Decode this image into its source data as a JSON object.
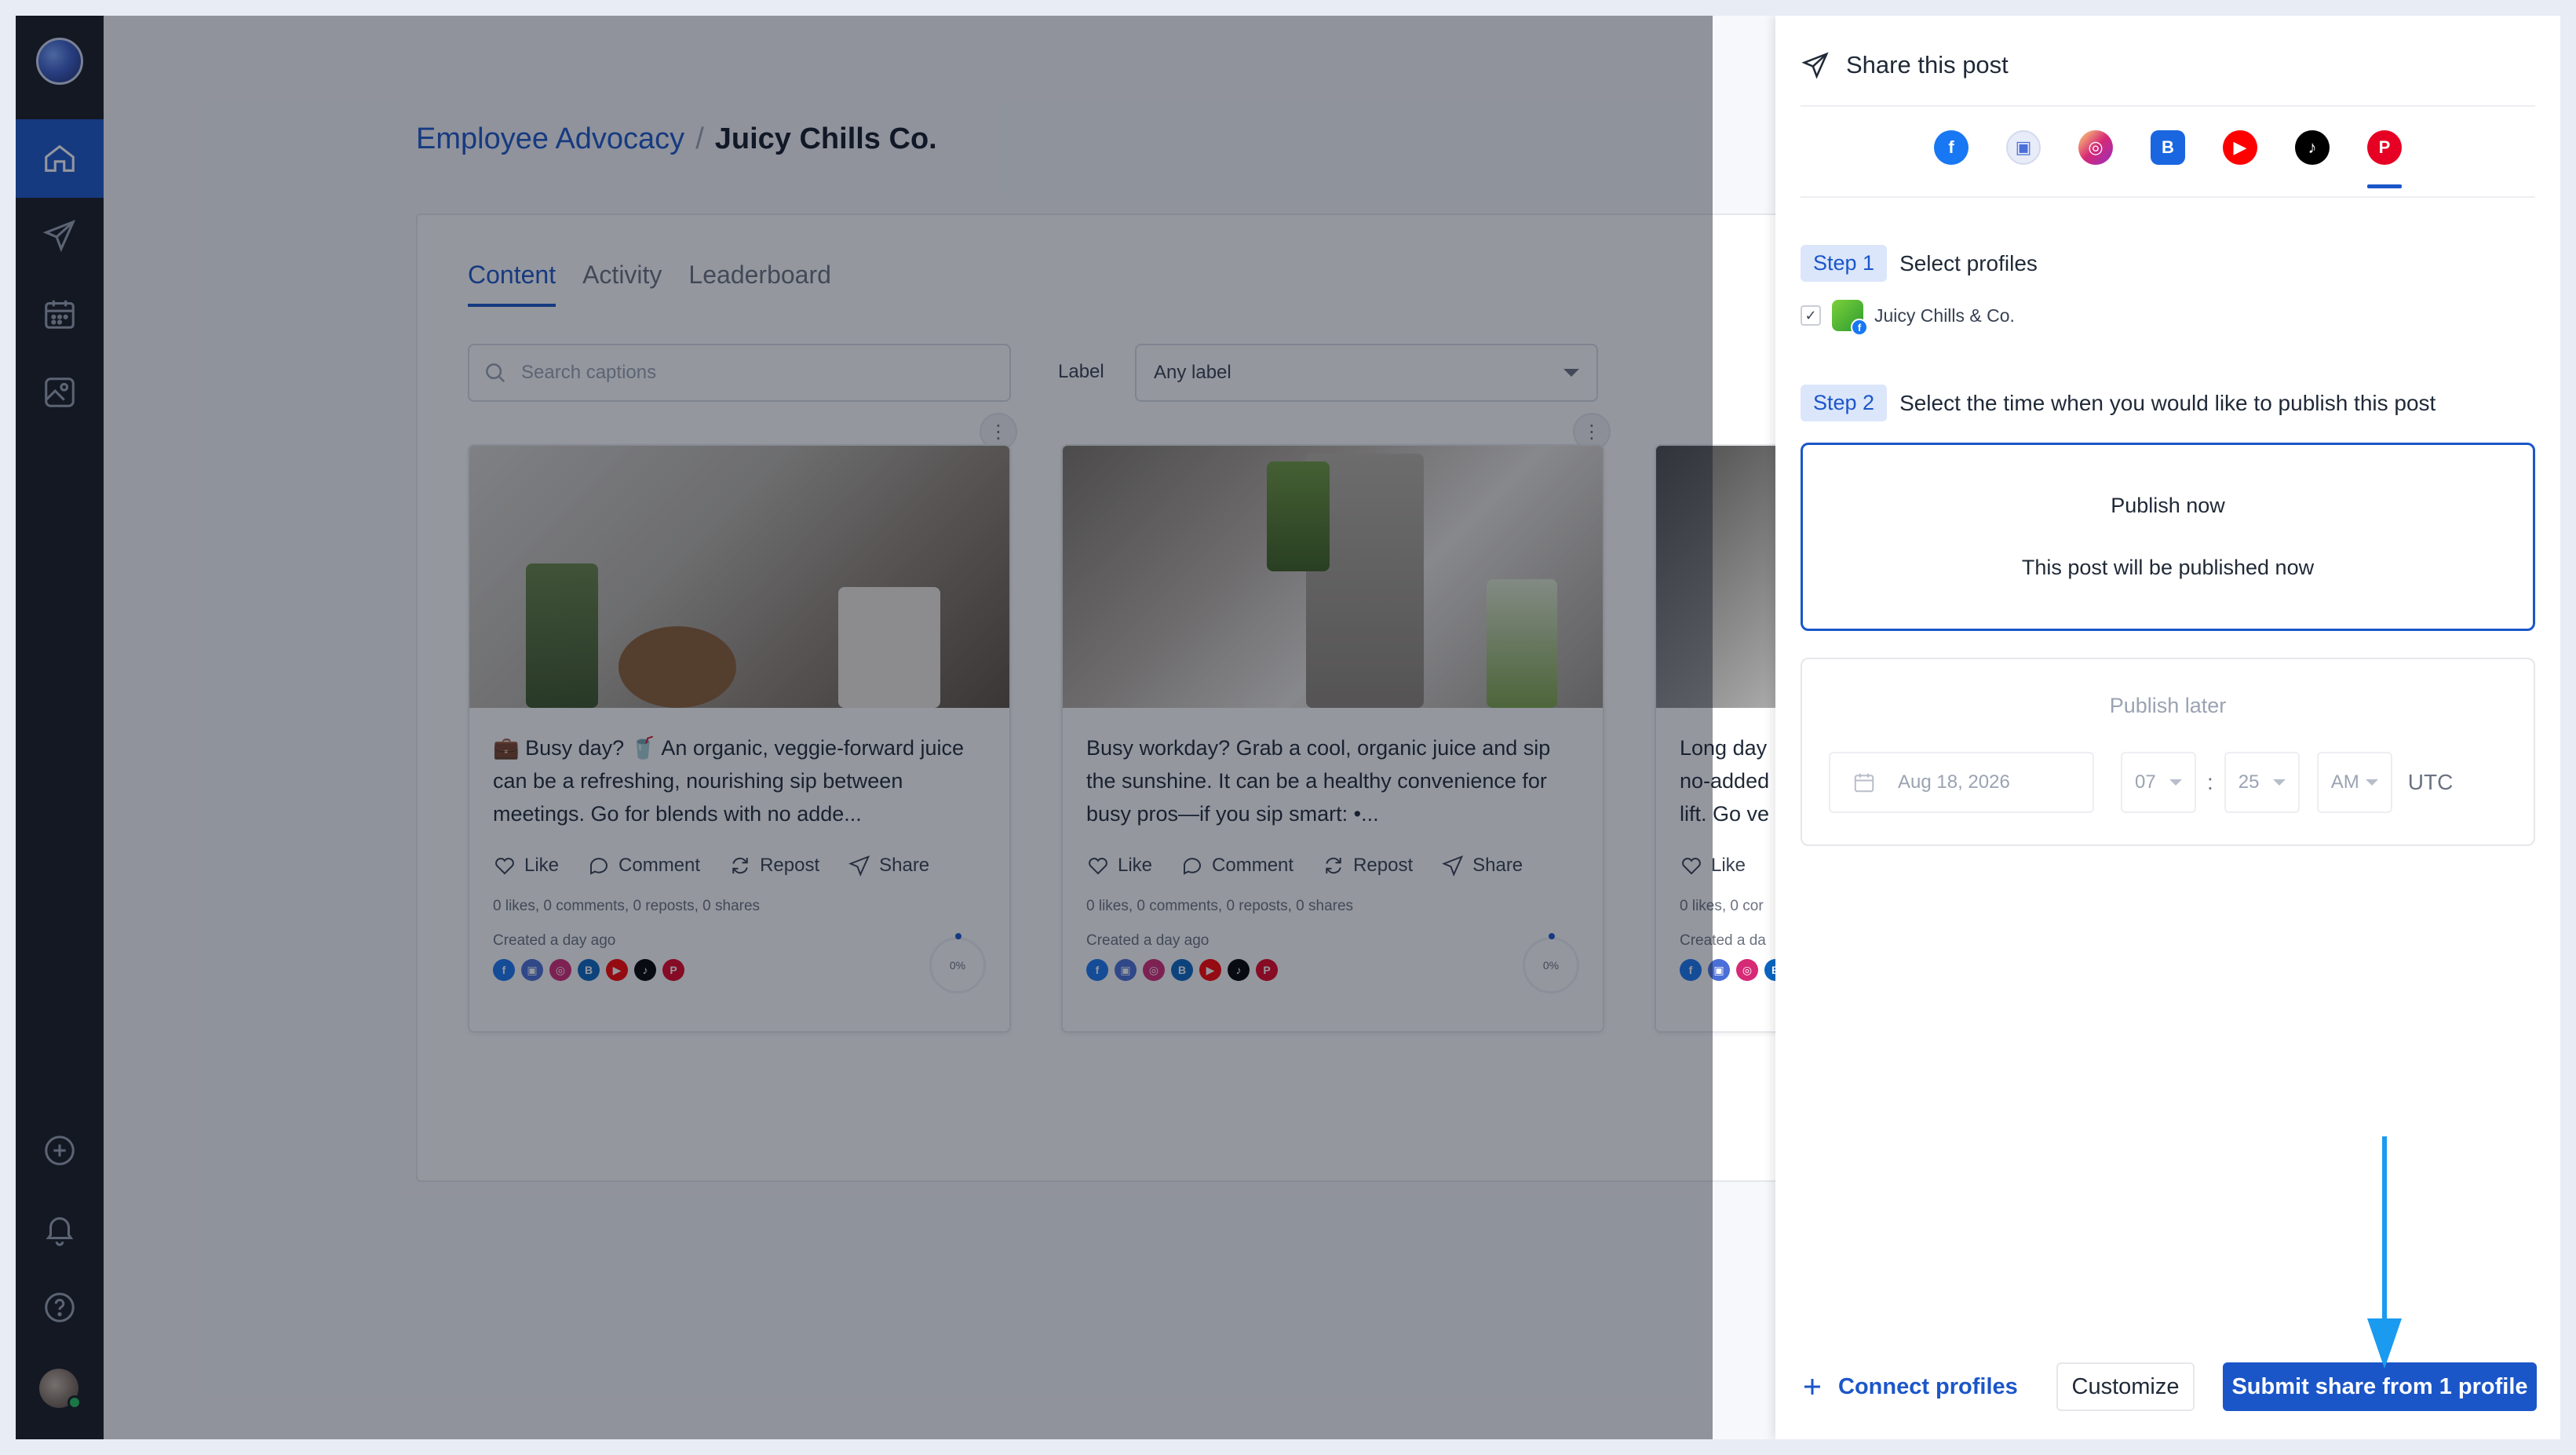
{
  "colors": {
    "accent": "#1b56c9",
    "sidebar_bg": "#14181f",
    "annotation_arrow": "#1a9bf0"
  },
  "sidebar": {
    "items": [
      {
        "icon": "home-icon",
        "active": true
      },
      {
        "icon": "send-icon",
        "active": false
      },
      {
        "icon": "calendar-icon",
        "active": false
      },
      {
        "icon": "image-icon",
        "active": false
      }
    ],
    "bottom_items": [
      {
        "icon": "plus-circle-icon"
      },
      {
        "icon": "bell-icon"
      },
      {
        "icon": "help-icon"
      }
    ]
  },
  "breadcrumb": {
    "parent": "Employee Advocacy",
    "separator": "/",
    "current": "Juicy Chills Co."
  },
  "tabs": [
    {
      "label": "Content",
      "active": true
    },
    {
      "label": "Activity",
      "active": false
    },
    {
      "label": "Leaderboard",
      "active": false
    }
  ],
  "filters": {
    "search_placeholder": "Search captions",
    "label_text": "Label",
    "label_value": "Any label"
  },
  "cards": [
    {
      "text": "💼 Busy day? 🥤 An organic, veggie-forward juice can be a refreshing, nourishing sip between meetings. Go for blends with no adde...",
      "actions": [
        "Like",
        "Comment",
        "Repost",
        "Share"
      ],
      "stats": "0 likes, 0 comments, 0 reposts, 0 shares",
      "created": "Created a day ago",
      "progress": "0%"
    },
    {
      "text": "Busy workday? Grab a cool, organic juice and sip the sunshine. It can be a healthy convenience for busy pros—if you sip smart: •...",
      "actions": [
        "Like",
        "Comment",
        "Repost",
        "Share"
      ],
      "stats": "0 likes, 0 comments, 0 reposts, 0 shares",
      "created": "Created a day ago",
      "progress": "0%"
    },
    {
      "text": "Long day no-added lift. Go ve",
      "actions": [
        "Like"
      ],
      "stats": "0 likes, 0 cor",
      "created": "Created a da"
    }
  ],
  "networks": [
    {
      "name": "facebook-icon",
      "color": "#1877f2",
      "glyph": "f"
    },
    {
      "name": "google-business-icon",
      "color": "#4a6fd8",
      "glyph": "▣"
    },
    {
      "name": "instagram-icon",
      "color": "#d62976",
      "glyph": "◎"
    },
    {
      "name": "linkedin-icon",
      "color": "#0a66c2",
      "glyph": "B"
    },
    {
      "name": "youtube-icon",
      "color": "#ff0000",
      "glyph": "▶"
    },
    {
      "name": "tiktok-icon",
      "color": "#000000",
      "glyph": "♪"
    },
    {
      "name": "pinterest-icon",
      "color": "#e60023",
      "glyph": "P"
    }
  ],
  "drawer": {
    "title": "Share this post",
    "step1_badge": "Step 1",
    "step1_text": "Select profiles",
    "profile_name": "Juicy Chills & Co.",
    "step2_badge": "Step 2",
    "step2_text": "Select the time when you would like to publish this post",
    "publish_now_title": "Publish now",
    "publish_now_desc": "This post will be published now",
    "publish_later_title": "Publish later",
    "date_value": "Aug 18, 2026",
    "hour_value": "07",
    "minute_value": "25",
    "ampm_value": "AM",
    "timezone": "UTC",
    "time_separator": ":",
    "connect_label": "Connect profiles",
    "customize_label": "Customize",
    "submit_label": "Submit share from 1 profile"
  }
}
